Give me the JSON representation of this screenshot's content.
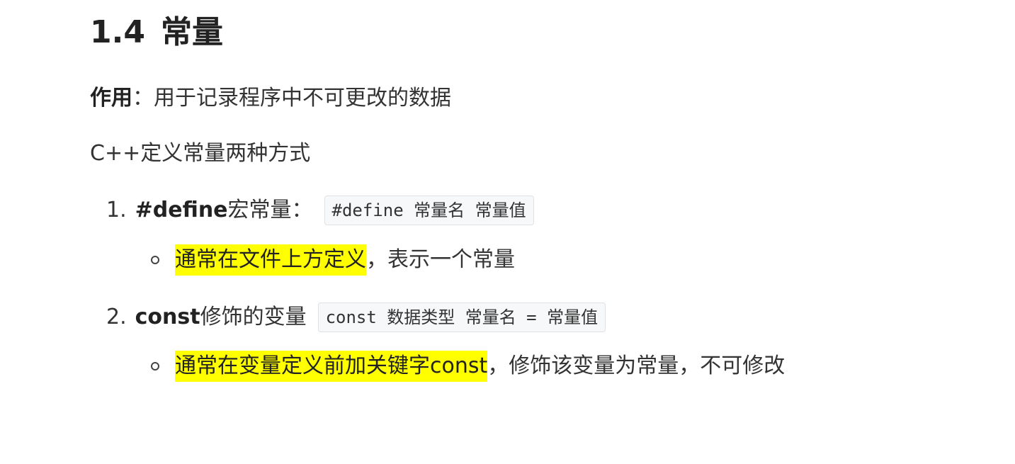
{
  "section": {
    "number": "1.4",
    "title": "常量"
  },
  "purpose": {
    "label": "作用",
    "separator": "：",
    "text": "用于记录程序中不可更改的数据"
  },
  "intro": "C++定义常量两种方式",
  "list": [
    {
      "marker": "1.",
      "keyword": "#define",
      "text": " 宏常量：",
      "code": "#define 常量名 常量值",
      "sub": {
        "highlight": "通常在文件上方定义",
        "rest": "，表示一个常量"
      }
    },
    {
      "marker": "2.",
      "keyword": "const",
      "text": "修饰的变量",
      "code": "const 数据类型 常量名 = 常量值",
      "sub": {
        "highlight": "通常在变量定义前加关键字const",
        "rest": "，修饰该变量为常量，不可修改"
      }
    }
  ],
  "colors": {
    "highlight": "#ffff00",
    "code_background": "#f6f8fa",
    "text": "#333333"
  }
}
